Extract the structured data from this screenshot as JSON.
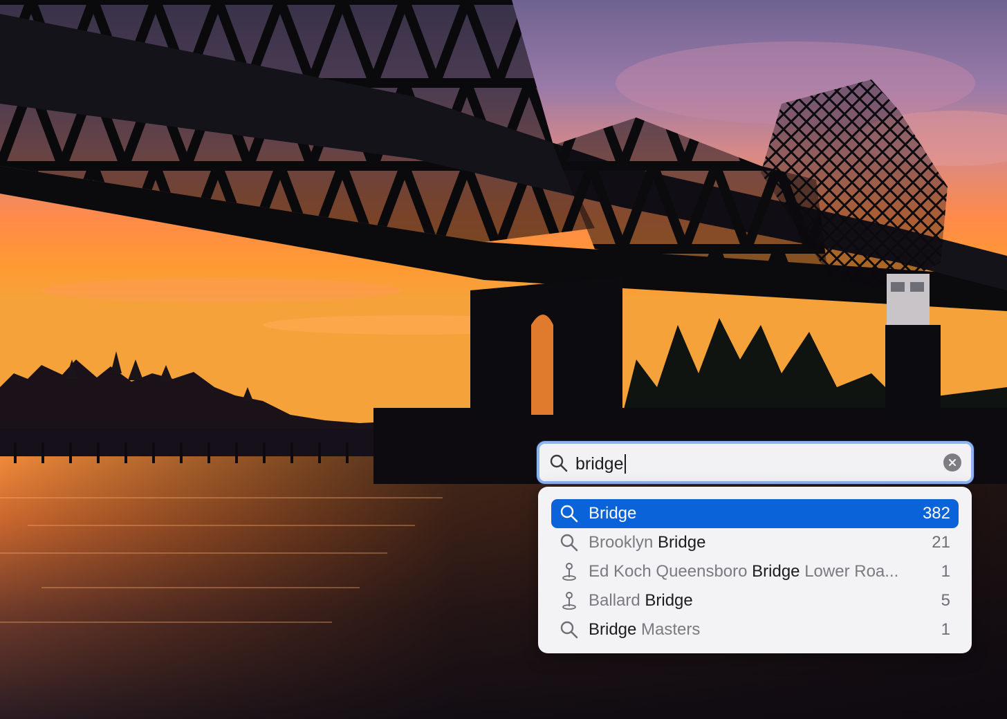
{
  "search": {
    "query": "bridge"
  },
  "suggestions": [
    {
      "icon": "magnifier-icon",
      "parts": [
        {
          "text": "Bridge",
          "dim": false
        }
      ],
      "count": "382",
      "selected": true
    },
    {
      "icon": "magnifier-icon",
      "parts": [
        {
          "text": "Brooklyn ",
          "dim": true
        },
        {
          "text": "Bridge",
          "dim": false
        }
      ],
      "count": "21",
      "selected": false
    },
    {
      "icon": "map-pin-icon",
      "parts": [
        {
          "text": "Ed Koch Queensboro ",
          "dim": true
        },
        {
          "text": "Bridge",
          "dim": false
        },
        {
          "text": " Lower Roa...",
          "dim": true
        }
      ],
      "count": "1",
      "selected": false
    },
    {
      "icon": "map-pin-icon",
      "parts": [
        {
          "text": "Ballard ",
          "dim": true
        },
        {
          "text": "Bridge",
          "dim": false
        }
      ],
      "count": "5",
      "selected": false
    },
    {
      "icon": "magnifier-icon",
      "parts": [
        {
          "text": "Bridge",
          "dim": false
        },
        {
          "text": " Masters",
          "dim": true
        }
      ],
      "count": "1",
      "selected": false
    }
  ],
  "colors": {
    "selection": "#0a63d8",
    "focus_ring": "#8fb4f2",
    "sky_top": "#7f6a9c",
    "sky_glow": "#ff8a2a"
  }
}
